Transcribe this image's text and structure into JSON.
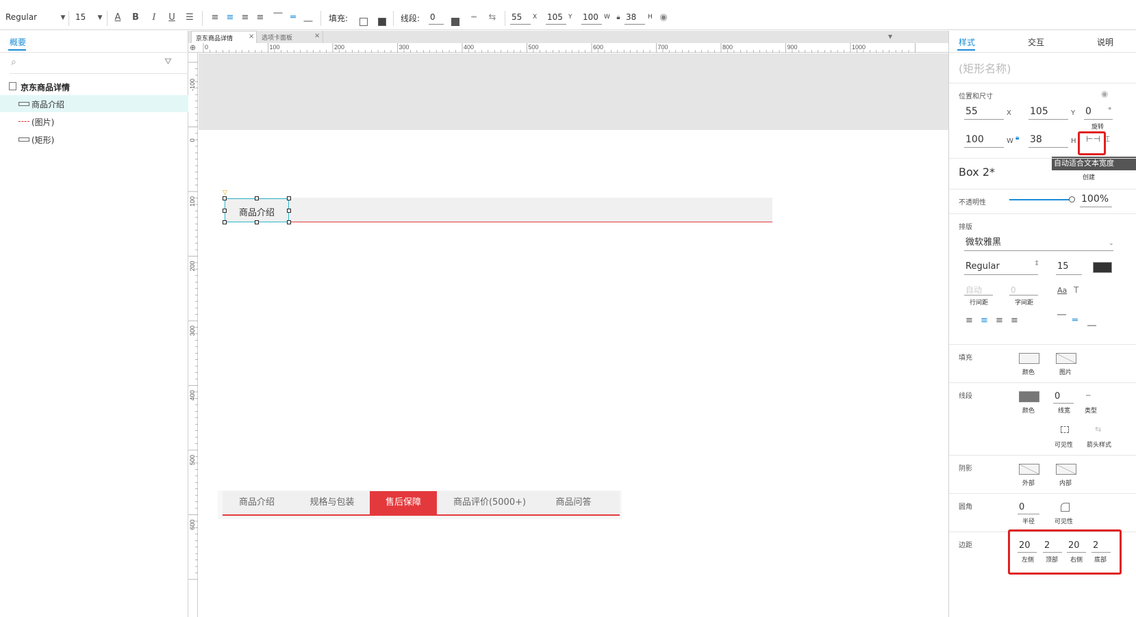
{
  "toolbar": {
    "font_style": "Regular",
    "font_size": "15",
    "fill_label": "填充:",
    "stroke_label": "线段:",
    "stroke_value": "0",
    "x_value": "55",
    "x_unit": "X",
    "y_value": "105",
    "y_unit": "Y",
    "w_value": "100",
    "w_unit": "W",
    "h_value": "38",
    "h_unit": "H"
  },
  "left": {
    "tab": "概要",
    "tree": {
      "root": "京东商品详情",
      "items": [
        "商品介绍",
        "(图片)",
        "(矩形)"
      ]
    }
  },
  "tabs": [
    {
      "label": "京东商品详情"
    },
    {
      "label": "选项卡面板"
    }
  ],
  "ruler": {
    "h": [
      "0",
      "100",
      "200",
      "300",
      "400",
      "500",
      "600",
      "700",
      "800",
      "900",
      "1000"
    ],
    "v": [
      "-100",
      "0",
      "100",
      "200",
      "300",
      "400",
      "500",
      "600"
    ]
  },
  "canvas": {
    "selected_text": "商品介绍",
    "tabbar": [
      "商品介绍",
      "规格与包装",
      "售后保障",
      "商品评价(5000+)",
      "商品问答"
    ],
    "active_tab": "售后保障",
    "colors": {
      "accent": "#e4393c",
      "selection": "#2fb5c9"
    }
  },
  "right": {
    "tabs": [
      "样式",
      "交互",
      "说明"
    ],
    "name_placeholder": "(矩形名称)",
    "pos_label": "位置和尺寸",
    "x": "55",
    "x_unit": "X",
    "y": "105",
    "y_unit": "Y",
    "rot": "0",
    "rot_unit": "°",
    "rot_label": "旋转",
    "w": "100",
    "w_unit": "W",
    "h": "38",
    "h_unit": "H",
    "tooltip": "自动适合文本宽度",
    "style_name": "Box 2*",
    "create_label": "创建",
    "opacity_label": "不透明性",
    "opacity_value": "100%",
    "opacity": 1.0,
    "typography_label": "排版",
    "font_family": "微软雅黑",
    "font_style": "Regular",
    "font_size": "15",
    "line_spacing_ph": "自动",
    "line_spacing_label": "行间距",
    "char_spacing_ph": "0",
    "char_spacing_label": "字间距",
    "fill_label": "填充",
    "fill_color_label": "颜色",
    "fill_image_label": "图片",
    "stroke_label": "线段",
    "stroke_color_label": "颜色",
    "stroke_width": "0",
    "stroke_width_label": "线宽",
    "stroke_type_label": "类型",
    "stroke_vis_label": "可见性",
    "stroke_arrow_label": "箭头样式",
    "shadow_label": "阴影",
    "shadow_outer": "外部",
    "shadow_inner": "内部",
    "corner_label": "圆角",
    "corner_radius": "0",
    "corner_radius_label": "半径",
    "corner_vis_label": "可见性",
    "padding_label": "边距",
    "pad_left": "20",
    "pad_left_label": "左侧",
    "pad_top": "2",
    "pad_top_label": "顶部",
    "pad_right": "20",
    "pad_right_label": "右侧",
    "pad_bottom": "2",
    "pad_bottom_label": "底部"
  }
}
